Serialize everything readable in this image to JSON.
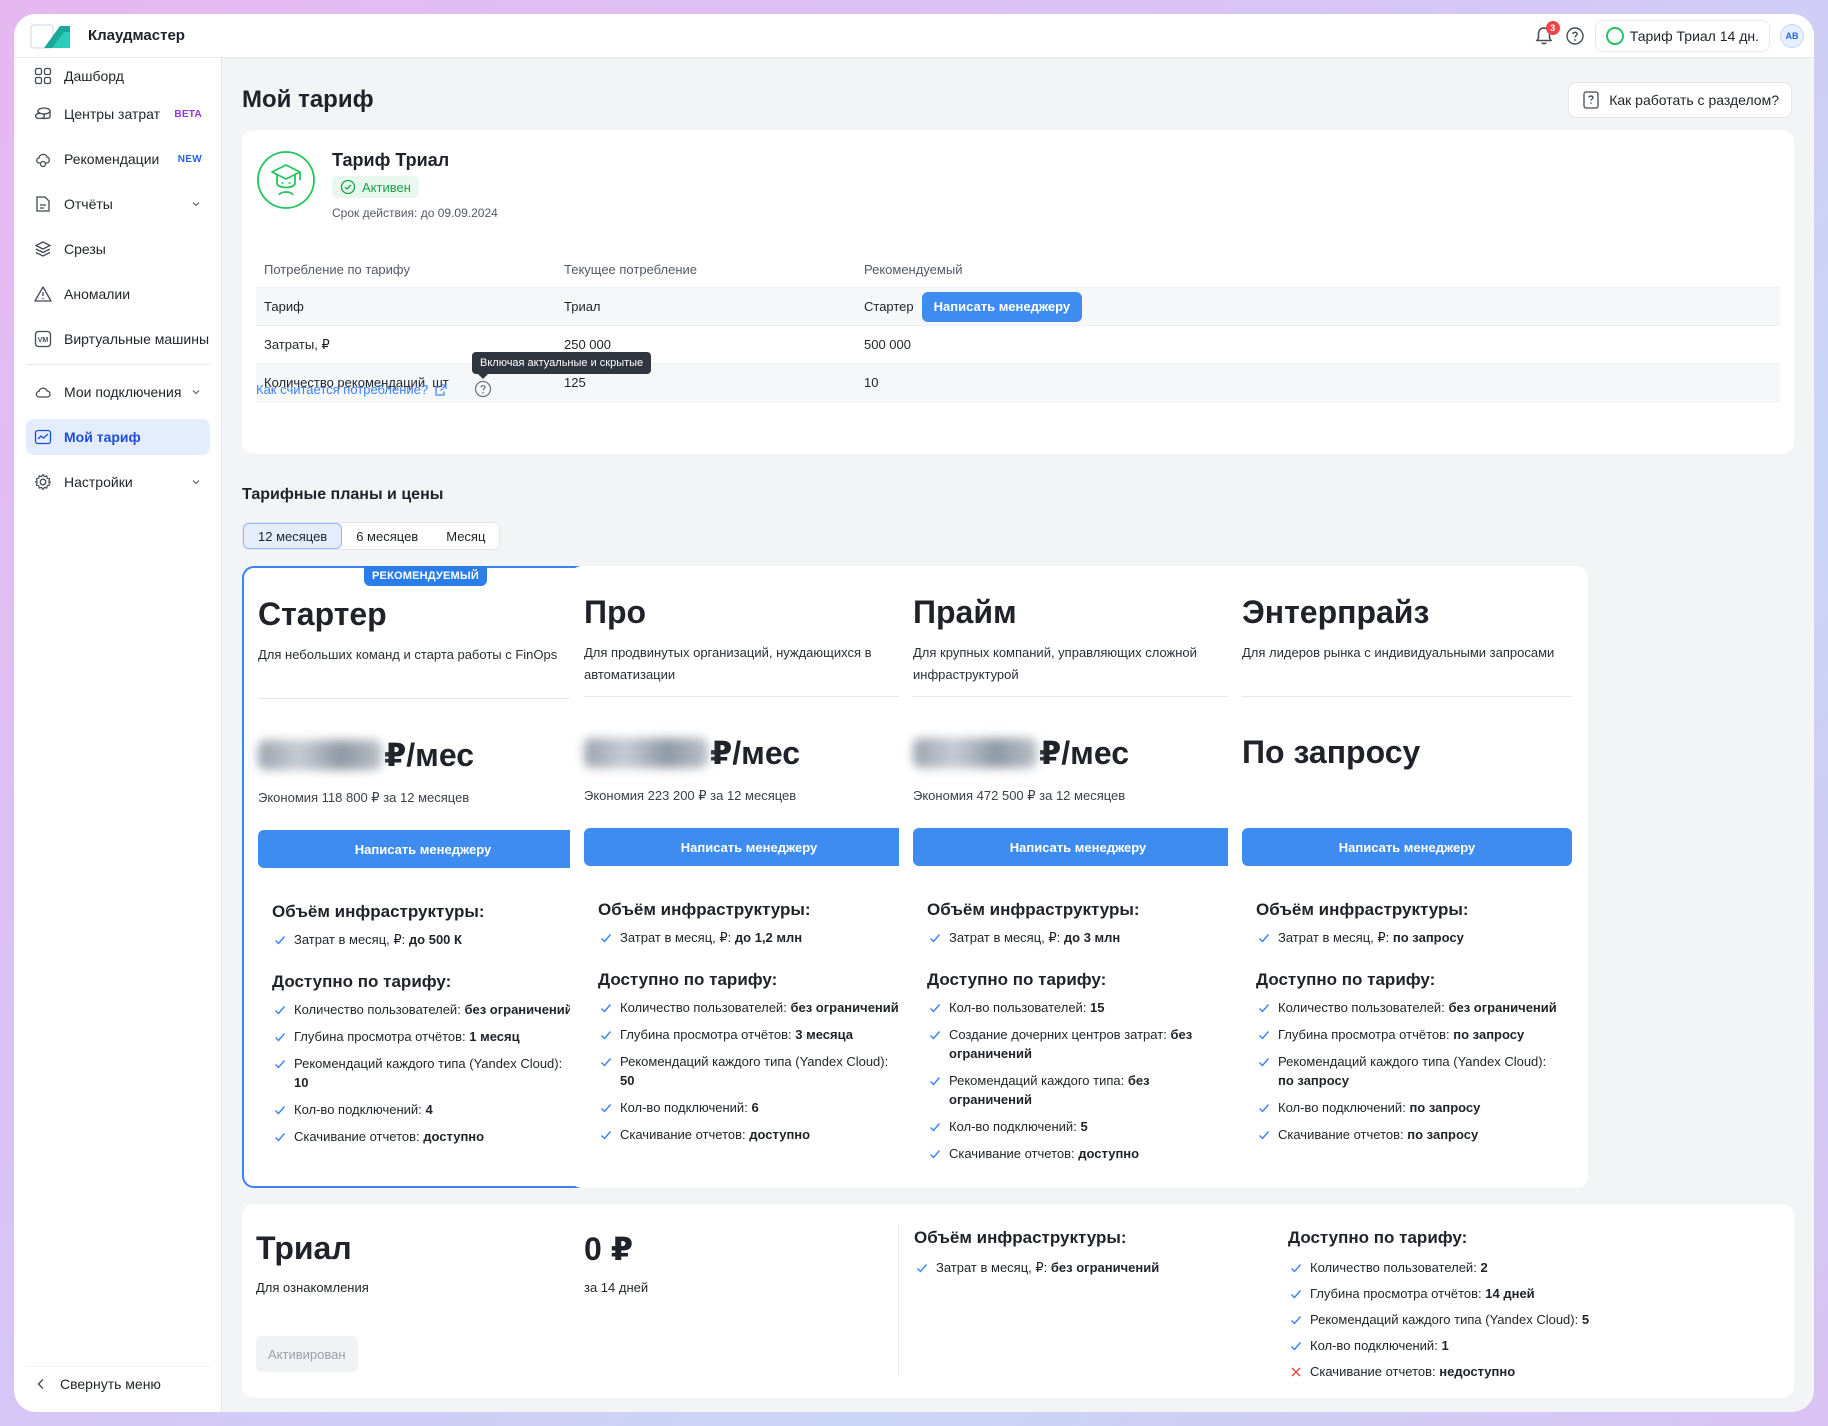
{
  "app": {
    "brand": "Клаудмастер",
    "notifications_count": "3",
    "plan_chip": "Тариф Триал 14 дн.",
    "avatar": "AB"
  },
  "sidebar": {
    "items": [
      {
        "label": "Дашборд",
        "icon": "dashboard-icon"
      },
      {
        "label": "Центры затрат",
        "tag": "BETA",
        "icon": "coins-icon"
      },
      {
        "label": "Рекомендации",
        "tag": "NEW",
        "icon": "recommendations-icon"
      },
      {
        "label": "Отчёты",
        "icon": "report-icon"
      },
      {
        "label": "Срезы",
        "icon": "layers-icon"
      },
      {
        "label": "Аномалии",
        "icon": "warning-icon"
      },
      {
        "label": "Виртуальные машины",
        "icon": "vm-icon"
      },
      {
        "label": "Мои подключения",
        "icon": "cloud-icon"
      },
      {
        "label": "Мой тариф",
        "icon": "tariff-icon"
      },
      {
        "label": "Настройки",
        "icon": "gear-icon"
      }
    ],
    "collapse_label": "Свернуть меню"
  },
  "page": {
    "title": "Мой тариф",
    "how_to_label": "Как работать с разделом?"
  },
  "current_plan": {
    "name": "Тариф Триал",
    "status": "Активен",
    "validity": "Срок действия: до 09.09.2024",
    "table": {
      "headers": [
        "Потребление по тарифу",
        "Текущее потребление",
        "Рекомендуемый"
      ],
      "rows": [
        [
          "Тариф",
          "Триал",
          "Стартер"
        ],
        [
          "Затраты, ₽",
          "250 000",
          "500 000"
        ],
        [
          "Количество рекомендаций, шт",
          "125",
          "10"
        ]
      ],
      "contact_button": "Написать менеджеру"
    },
    "tooltip": "Включая актуальные и скрытые",
    "calc_link": "Как считается потребление?"
  },
  "plans_section": {
    "title": "Тарифные планы и цены",
    "periods": [
      "12 месяцев",
      "6 месяцев",
      "Месяц"
    ],
    "active_period": "12 месяцев",
    "recommended_badge": "РЕКОМЕНДУЕМЫЙ",
    "infra_heading": "Объём инфраструктуры:",
    "features_heading": "Доступно по тарифу:",
    "button_label": "Написать менеджеру",
    "plans": [
      {
        "name": "Стартер",
        "desc": "Для небольших команд и старта работы с FinOps",
        "price_suffix": "₽/мес",
        "savings": "Экономия 118 800 ₽ за 12 месяцев",
        "infra": {
          "label": "Затрат в месяц, ₽:",
          "value": "до 500 К"
        },
        "features": [
          {
            "label": "Количество пользователей:",
            "value": "без ограничений"
          },
          {
            "label": "Глубина просмотра отчётов:",
            "value": "1 месяц"
          },
          {
            "label": "Рекомендаций каждого типа (Yandex Cloud):",
            "value": "10"
          },
          {
            "label": "Кол-во подключений:",
            "value": "4"
          },
          {
            "label": "Скачивание отчетов:",
            "value": "доступно"
          }
        ]
      },
      {
        "name": "Про",
        "desc": "Для продвинутых организаций, нуждающихся в автоматизации",
        "price_suffix": "₽/мес",
        "savings": "Экономия 223 200 ₽ за 12 месяцев",
        "infra": {
          "label": "Затрат в месяц, ₽:",
          "value": "до 1,2 млн"
        },
        "features": [
          {
            "label": "Количество пользователей:",
            "value": "без ограничений"
          },
          {
            "label": "Глубина просмотра отчётов:",
            "value": "3 месяца"
          },
          {
            "label": "Рекомендаций каждого типа (Yandex Cloud):",
            "value": "50"
          },
          {
            "label": "Кол-во подключений:",
            "value": "6"
          },
          {
            "label": "Скачивание отчетов:",
            "value": "доступно"
          }
        ]
      },
      {
        "name": "Прайм",
        "desc": "Для крупных компаний, управляющих сложной инфраструктурой",
        "price_suffix": "₽/мес",
        "savings": "Экономия 472 500 ₽ за 12 месяцев",
        "infra": {
          "label": "Затрат в месяц, ₽:",
          "value": "до 3 млн"
        },
        "features": [
          {
            "label": "Кол-во пользователей:",
            "value": "15"
          },
          {
            "label": "Создание дочерних центров затрат:",
            "value": "без ограничений"
          },
          {
            "label": "Рекомендаций каждого типа:",
            "value": "без ограничений"
          },
          {
            "label": "Кол-во подключений:",
            "value": "5"
          },
          {
            "label": "Скачивание отчетов:",
            "value": "доступно"
          }
        ]
      },
      {
        "name": "Энтерпрайз",
        "desc": "Для лидеров рынка с индивидуальными запросами",
        "price_text": "По запросу",
        "infra": {
          "label": "Затрат в месяц, ₽:",
          "value": "по запросу"
        },
        "features": [
          {
            "label": "Количество пользователей:",
            "value": "без ограничений"
          },
          {
            "label": "Глубина просмотра отчётов:",
            "value": "по запросу"
          },
          {
            "label": "Рекомендаций каждого типа (Yandex Cloud):",
            "value": "по запросу"
          },
          {
            "label": "Кол-во подключений:",
            "value": "по запросу"
          },
          {
            "label": "Скачивание отчетов:",
            "value": "по запросу"
          }
        ]
      }
    ]
  },
  "trial_plan": {
    "name": "Триал",
    "desc": "Для ознакомления",
    "price": "0 ₽",
    "period": "за 14 дней",
    "button": "Активирован",
    "infra_heading": "Объём инфраструктуры:",
    "infra": {
      "label": "Затрат в месяц, ₽:",
      "value": "без ограничений"
    },
    "features_heading": "Доступно по тарифу:",
    "features": [
      {
        "label": "Количество пользователей:",
        "value": "2",
        "ok": true
      },
      {
        "label": "Глубина просмотра отчётов:",
        "value": "14 дней",
        "ok": true
      },
      {
        "label": "Рекомендаций каждого типа (Yandex Cloud):",
        "value": "5",
        "ok": true
      },
      {
        "label": "Кол-во подключений:",
        "value": "1",
        "ok": true
      },
      {
        "label": "Скачивание отчетов:",
        "value": "недоступно",
        "ok": false
      }
    ]
  },
  "colors": {
    "accent": "#3f8cf0",
    "success": "#22c55e",
    "error": "#ef4444"
  }
}
